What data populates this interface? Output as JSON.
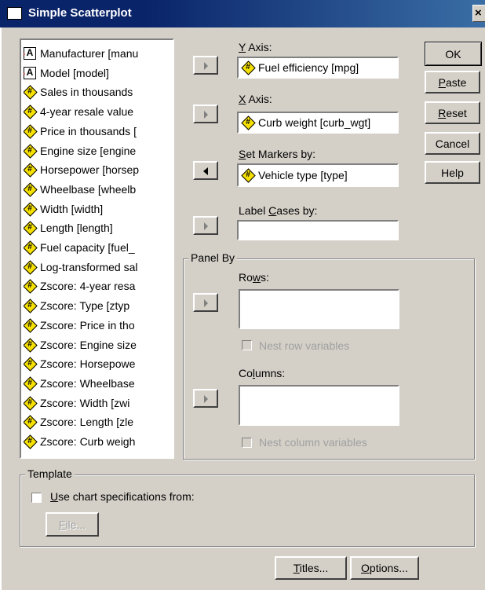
{
  "window": {
    "title": "Simple Scatterplot",
    "close_glyph": "×"
  },
  "variables": [
    {
      "label": "Manufacturer [manu",
      "type": "string"
    },
    {
      "label": "Model [model]",
      "type": "string"
    },
    {
      "label": "Sales in thousands",
      "type": "numeric"
    },
    {
      "label": "4-year resale value",
      "type": "numeric"
    },
    {
      "label": "Price in thousands [",
      "type": "numeric"
    },
    {
      "label": "Engine size [engine",
      "type": "numeric"
    },
    {
      "label": "Horsepower [horsep",
      "type": "numeric"
    },
    {
      "label": "Wheelbase [wheelb",
      "type": "numeric"
    },
    {
      "label": "Width [width]",
      "type": "numeric"
    },
    {
      "label": "Length [length]",
      "type": "numeric"
    },
    {
      "label": "Fuel capacity [fuel_",
      "type": "numeric"
    },
    {
      "label": "Log-transformed sal",
      "type": "numeric"
    },
    {
      "label": "Zscore:  4-year resa",
      "type": "numeric"
    },
    {
      "label": "Zscore:  Type [ztyp",
      "type": "numeric"
    },
    {
      "label": "Zscore:  Price in tho",
      "type": "numeric"
    },
    {
      "label": "Zscore:  Engine size",
      "type": "numeric"
    },
    {
      "label": "Zscore:  Horsepowe",
      "type": "numeric"
    },
    {
      "label": "Zscore:  Wheelbase",
      "type": "numeric"
    },
    {
      "label": "Zscore:  Width [zwi",
      "type": "numeric"
    },
    {
      "label": "Zscore:  Length [zle",
      "type": "numeric"
    },
    {
      "label": "Zscore:  Curb weigh",
      "type": "numeric"
    }
  ],
  "y_axis": {
    "label_pre": "",
    "label_key": "Y",
    "label_post": " Axis:",
    "value": "Fuel efficiency [mpg]"
  },
  "x_axis": {
    "label_pre": "",
    "label_key": "X",
    "label_post": " Axis:",
    "value": "Curb weight [curb_wgt]"
  },
  "markers": {
    "label_pre": "",
    "label_key": "S",
    "label_post": "et Markers by:",
    "value": "Vehicle type [type]"
  },
  "label_cases": {
    "label_pre": "Label ",
    "label_key": "C",
    "label_post": "ases by:",
    "value": ""
  },
  "panel_by": {
    "title": "Panel By",
    "rows_label_pre": "Ro",
    "rows_label_key": "w",
    "rows_label_post": "s:",
    "nest_rows": "Nest row variables",
    "columns_label_pre": "Co",
    "columns_label_key": "l",
    "columns_label_post": "umns:",
    "nest_columns": "Nest column variables"
  },
  "template": {
    "title": "Template",
    "use_spec_key": "U",
    "use_spec_rest": "se chart specifications from:",
    "file_key": "F",
    "file_rest": "ile..."
  },
  "buttons": {
    "ok": "OK",
    "paste_key": "P",
    "paste_rest": "aste",
    "reset_key": "R",
    "reset_rest": "eset",
    "cancel": "Cancel",
    "help": "Help",
    "titles_key": "T",
    "titles_rest": "itles...",
    "options_key": "O",
    "options_rest": "ptions..."
  }
}
